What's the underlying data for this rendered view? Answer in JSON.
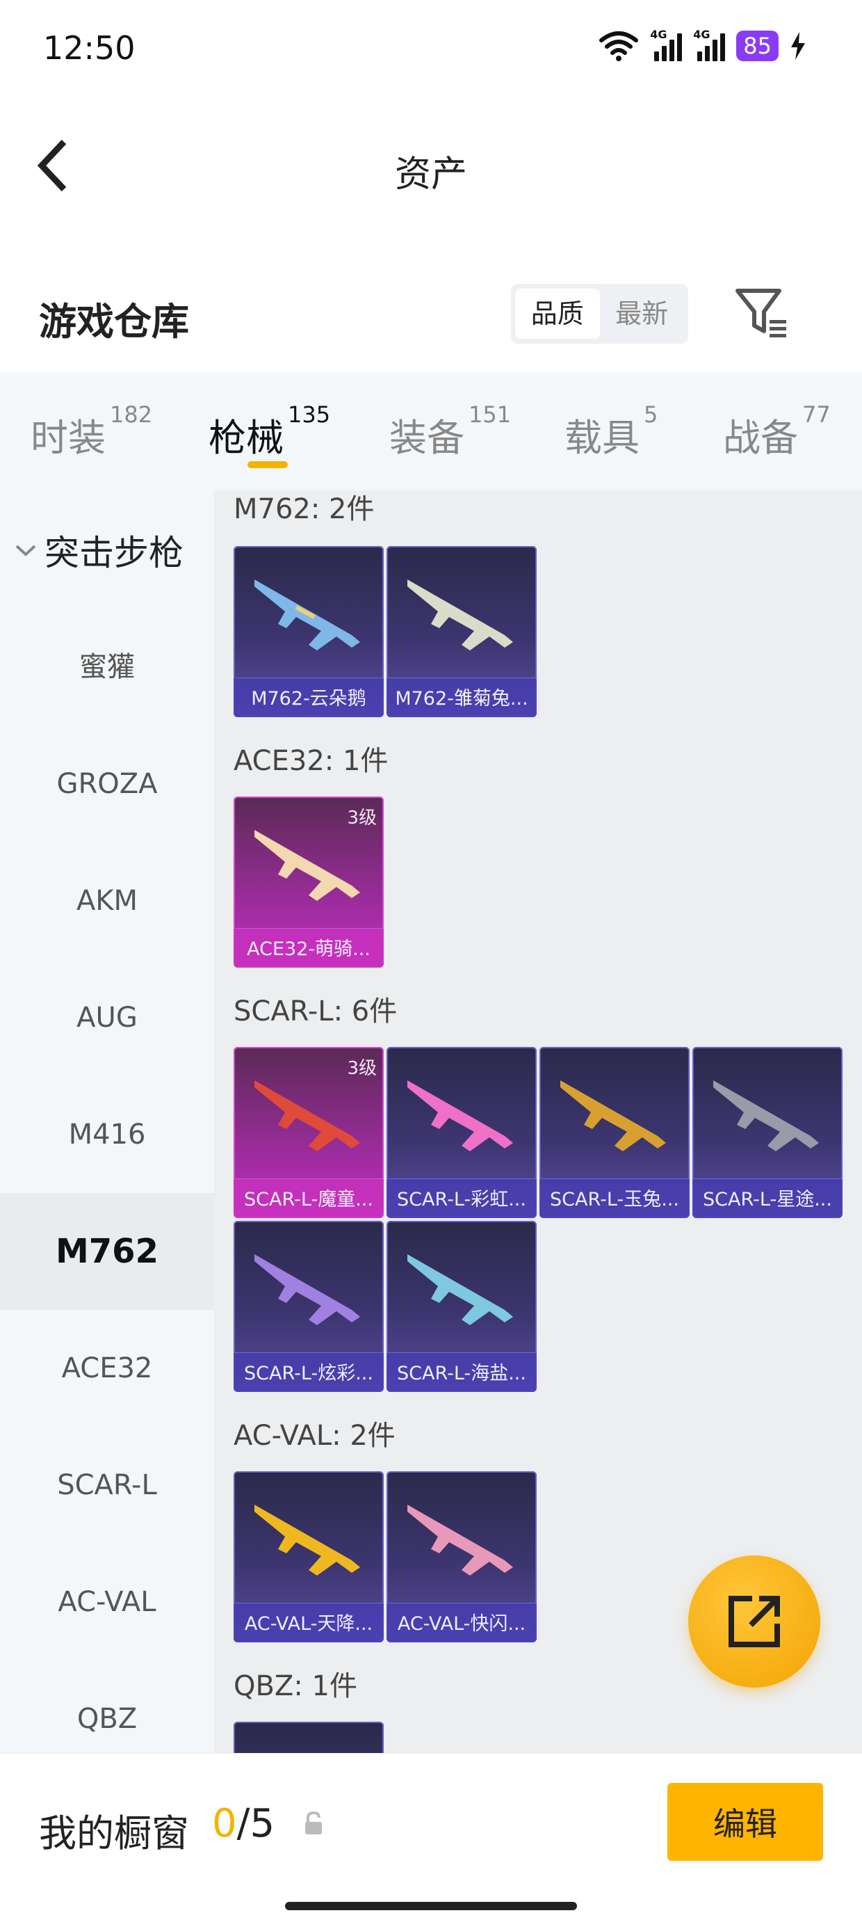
{
  "status_bar": {
    "time": "12:50",
    "battery": "85",
    "net1": "4G",
    "net2": "4G"
  },
  "nav": {
    "title": "资产"
  },
  "header": {
    "title": "游戏仓库",
    "sort_options": [
      "品质",
      "最新"
    ]
  },
  "tabs": [
    {
      "label": "时装",
      "count": "182"
    },
    {
      "label": "枪械",
      "count": "135"
    },
    {
      "label": "装备",
      "count": "151"
    },
    {
      "label": "载具",
      "count": "5"
    },
    {
      "label": "战备",
      "count": "77"
    }
  ],
  "sidebar": {
    "group": "突击步枪",
    "items": [
      "蜜獾",
      "GROZA",
      "AKM",
      "AUG",
      "M416",
      "M762",
      "ACE32",
      "SCAR-L",
      "AC-VAL",
      "QBZ"
    ]
  },
  "sections": [
    {
      "title": "M762: 2件",
      "items": [
        {
          "name": "M762-云朵鹅",
          "level": ""
        },
        {
          "name": "M762-雏菊兔...",
          "level": ""
        }
      ]
    },
    {
      "title": "ACE32: 1件",
      "items": [
        {
          "name": "ACE32-萌骑...",
          "level": "3级"
        }
      ]
    },
    {
      "title": "SCAR-L: 6件",
      "items": [
        {
          "name": "SCAR-L-魔童...",
          "level": "3级"
        },
        {
          "name": "SCAR-L-彩虹...",
          "level": ""
        },
        {
          "name": "SCAR-L-玉兔...",
          "level": ""
        },
        {
          "name": "SCAR-L-星途...",
          "level": ""
        },
        {
          "name": "SCAR-L-炫彩...",
          "level": ""
        },
        {
          "name": "SCAR-L-海盐...",
          "level": ""
        }
      ]
    },
    {
      "title": "AC-VAL: 2件",
      "items": [
        {
          "name": "AC-VAL-天降...",
          "level": ""
        },
        {
          "name": "AC-VAL-快闪...",
          "level": ""
        }
      ]
    },
    {
      "title": "QBZ: 1件",
      "items": []
    }
  ],
  "bottom": {
    "label": "我的橱窗",
    "count_current": "0",
    "count_total": "/5",
    "edit_label": "编辑"
  },
  "colors": {
    "accent": "#ffb400",
    "battery": "#8a3cf5",
    "sidebar_bg": "#f4f7fa",
    "content_bg": "#eceef0"
  }
}
